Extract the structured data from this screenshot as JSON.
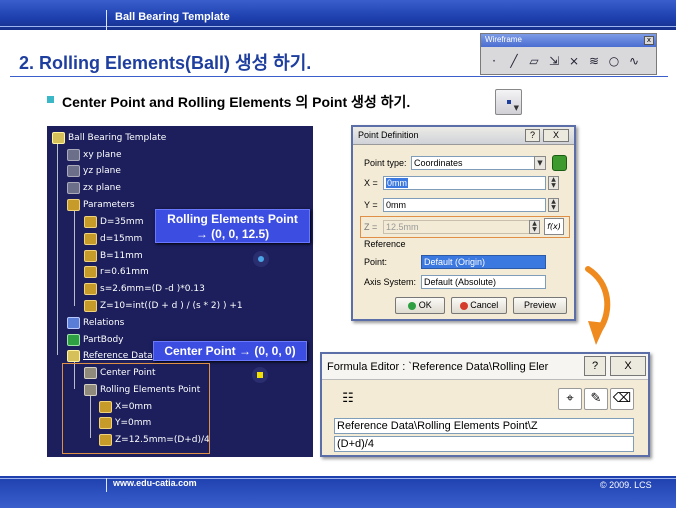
{
  "header": {
    "template_title": "Ball Bearing Template"
  },
  "slide": {
    "title": "2. Rolling Elements(Ball) 생성 하기.",
    "bullet": "Center Point and Rolling Elements 의 Point 생성 하기."
  },
  "wireframe_toolbar": {
    "title": "Wireframe",
    "close": "x",
    "icons": [
      "point-icon",
      "line-icon",
      "plane-icon",
      "projection-icon",
      "intersection-icon",
      "parallel-curve-icon",
      "circle-icon",
      "spline-icon"
    ]
  },
  "spec_tree": {
    "items": [
      {
        "label": "Ball Bearing Template",
        "icon": "product-root-icon"
      },
      {
        "label": "xy plane",
        "icon": "plane-icon"
      },
      {
        "label": "yz plane",
        "icon": "plane-icon"
      },
      {
        "label": "zx plane",
        "icon": "plane-icon"
      },
      {
        "label": "Parameters",
        "icon": "parameters-icon"
      },
      {
        "label": "D=35mm",
        "icon": "parameter-icon"
      },
      {
        "label": "d=15mm",
        "icon": "parameter-icon"
      },
      {
        "label": "B=11mm",
        "icon": "parameter-icon"
      },
      {
        "label": "r=0.61mm",
        "icon": "parameter-icon"
      },
      {
        "label": "s=2.6mm=(D -d )*0.13",
        "icon": "formula-parameter-icon"
      },
      {
        "label": "Z=10=int((D + d ) / (s * 2) ) +1",
        "icon": "formula-parameter-icon"
      },
      {
        "label": "Relations",
        "icon": "relations-icon"
      },
      {
        "label": "PartBody",
        "icon": "partbody-icon"
      },
      {
        "label": "Reference Data",
        "icon": "reference-data-icon"
      },
      {
        "label": "Center Point",
        "icon": "point-icon"
      },
      {
        "label": "Rolling Elements Point",
        "icon": "point-icon"
      },
      {
        "label": "X=0mm",
        "icon": "parameter-icon"
      },
      {
        "label": "Y=0mm",
        "icon": "parameter-icon"
      },
      {
        "label": "Z=12.5mm=(D+d)/4",
        "icon": "formula-parameter-icon"
      }
    ],
    "label_rolling": "Rolling Elements Point\n→ (0, 0, 12.5)",
    "label_center": "Center Point → (0, 0, 0)"
  },
  "point_dialog": {
    "title": "Point Definition",
    "help": "?",
    "close": "X",
    "point_type_label": "Point type:",
    "point_type_value": "Coordinates",
    "x_label": "X =",
    "x_value": "0mm",
    "y_label": "Y =",
    "y_value": "0mm",
    "z_label": "Z =",
    "z_value": "12.5mm",
    "reference_label": "Reference",
    "point_label": "Point:",
    "point_value": "Default (Origin)",
    "axis_label": "Axis System:",
    "axis_value": "Default (Absolute)",
    "ok": "OK",
    "cancel": "Cancel",
    "preview": "Preview",
    "fx_symbol": "f(x)"
  },
  "formula_editor": {
    "title": "Formula Editor : `Reference Data\\Rolling Eler",
    "help": "?",
    "close": "X",
    "path": "Reference Data\\Rolling Elements Point\\Z",
    "formula": "(D+d)/4"
  },
  "footer": {
    "url": "www.edu-catia.com",
    "copyright": "© 2009. LCS"
  },
  "colors": {
    "banner": "#1d3fae",
    "heading": "#1f3f9f",
    "tree_bg": "#1c1f5c",
    "label_bg": "#3c4de2",
    "dialog_bg": "#f3ebd6",
    "highlight": "#e08f46",
    "selected_field": "#3b78e0"
  }
}
